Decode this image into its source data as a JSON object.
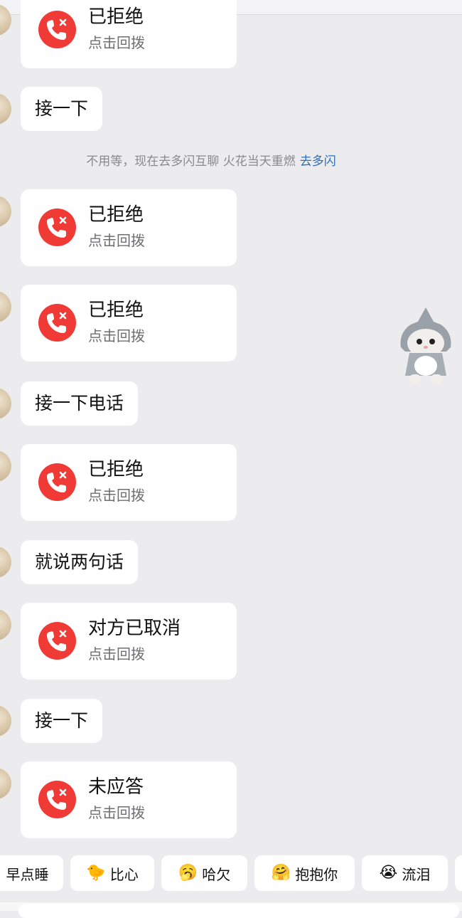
{
  "messages": {
    "m1": {
      "title": "已拒绝",
      "sub": "点击回拨"
    },
    "m2": {
      "text": "接一下"
    },
    "notice": {
      "text": "不用等，现在去多闪互聊 火花当天重燃",
      "link": "去多闪"
    },
    "m3": {
      "title": "已拒绝",
      "sub": "点击回拨"
    },
    "m4": {
      "title": "已拒绝",
      "sub": "点击回拨"
    },
    "m5": {
      "text": "接一下电话"
    },
    "m6": {
      "title": "已拒绝",
      "sub": "点击回拨"
    },
    "m7": {
      "text": "就说两句话"
    },
    "m8": {
      "title": "对方已取消",
      "sub": "点击回拨"
    },
    "m9": {
      "text": "接一下"
    },
    "m10": {
      "title": "未应答",
      "sub": "点击回拨"
    }
  },
  "quick_replies": [
    {
      "label": "早点睡",
      "emoji": ""
    },
    {
      "label": "比心",
      "emoji": "🐤"
    },
    {
      "label": "哈欠",
      "emoji": "🥱"
    },
    {
      "label": "抱抱你",
      "emoji": "🤗"
    },
    {
      "label": "流泪",
      "emoji": "😭"
    }
  ],
  "icons": {
    "call_declined": "phone-declined-icon",
    "sticker": "shark-cat-sticker"
  },
  "colors": {
    "call_icon_bg": "#f03a36",
    "link": "#2d6fb6",
    "background": "#ececee"
  }
}
